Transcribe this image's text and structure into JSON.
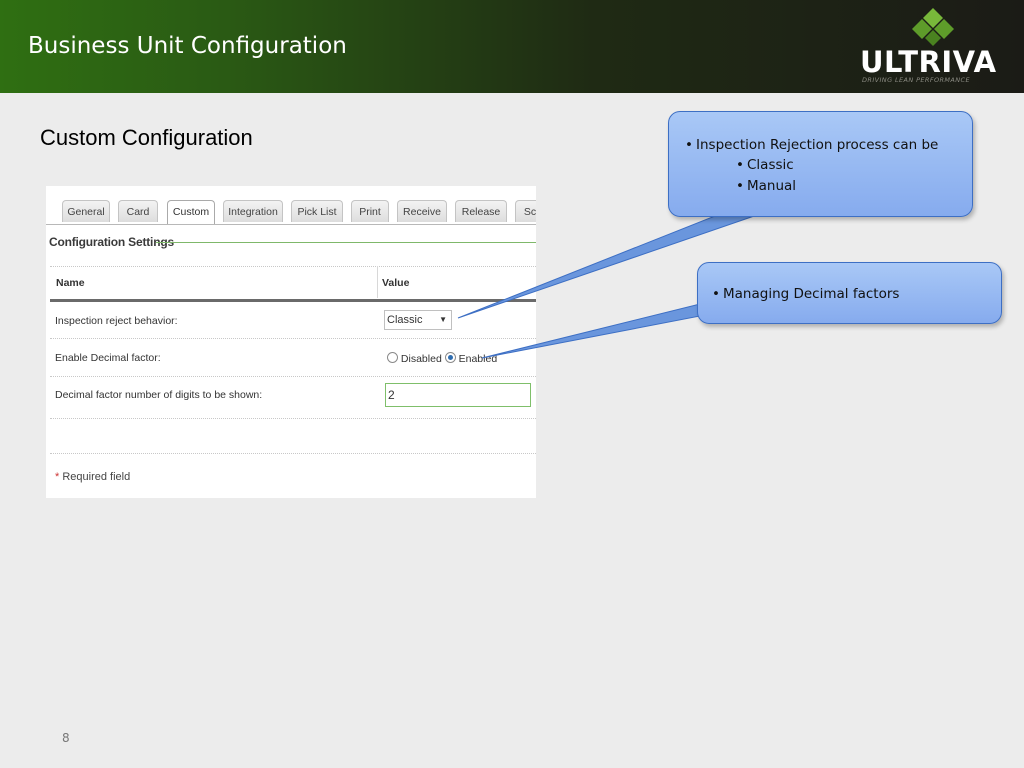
{
  "slide": {
    "title": "Business Unit Configuration",
    "section_heading": "Custom Configuration",
    "page_number": "8"
  },
  "logo": {
    "word": "ULTRIVA",
    "tagline": "DRIVING LEAN PERFORMANCE"
  },
  "screenshot": {
    "tabs": [
      {
        "label": "General",
        "active": false
      },
      {
        "label": "Card",
        "active": false
      },
      {
        "label": "Custom",
        "active": true
      },
      {
        "label": "Integration",
        "active": false
      },
      {
        "label": "Pick List",
        "active": false
      },
      {
        "label": "Print",
        "active": false
      },
      {
        "label": "Receive",
        "active": false
      },
      {
        "label": "Release",
        "active": false
      },
      {
        "label": "Sc",
        "active": false
      }
    ],
    "section_title": "Configuration Settings",
    "columns": {
      "name": "Name",
      "value": "Value"
    },
    "rows": {
      "inspection_label": "Inspection reject behavior:",
      "inspection_value": "Classic",
      "decimal_label": "Enable Decimal factor:",
      "decimal_options": {
        "disabled": "Disabled",
        "enabled": "Enabled",
        "selected": "Enabled"
      },
      "digits_label": "Decimal factor number of digits to be shown:",
      "digits_value": "2"
    },
    "required": {
      "star": "*",
      "text": "Required field"
    }
  },
  "callouts": {
    "first": {
      "main": "Inspection Rejection process can be",
      "sub_items": [
        "Classic",
        "Manual"
      ]
    },
    "second": {
      "main": "Managing Decimal factors"
    }
  },
  "colors": {
    "callout_fill": "#9ebcf3",
    "callout_border": "#3d6fc4",
    "accent_green": "#4f9a28"
  }
}
